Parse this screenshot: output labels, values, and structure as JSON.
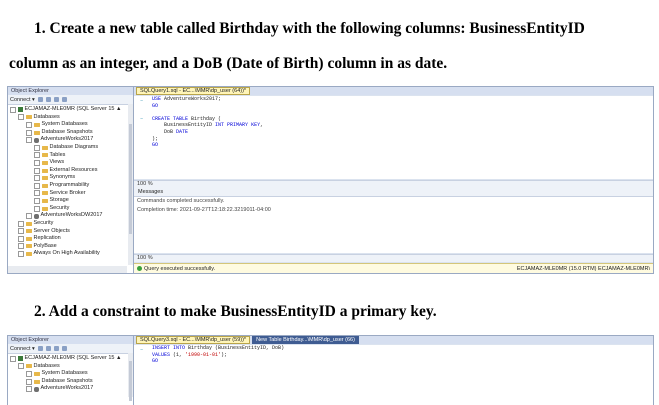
{
  "steps": {
    "step1_line1": "1.  Create a new table called Birthday with the following columns: BusinessEntityID",
    "step1_line2": "column as an integer, and a DoB (Date of Birth) column in as date.",
    "step2": "2.  Add a constraint to make BusinessEntityID a primary key."
  },
  "screenshot1": {
    "object_explorer": {
      "title": "Object Explorer",
      "connect_label": "Connect ▾",
      "tree": [
        "ECJAMAZ-MLE0MR (SQL Server 15 ▲",
        "Databases",
        "System Databases",
        "Database Snapshots",
        "AdventureWorks2017",
        "Database Diagrams",
        "Tables",
        "Views",
        "External Resources",
        "Synonyms",
        "Programmability",
        "Service Broker",
        "Storage",
        "Security",
        "AdventureWorksDW2017",
        "Security",
        "Server Objects",
        "Replication",
        "PolyBase",
        "Always On High Availability"
      ]
    },
    "tab": "SQLQuery1.sql - EC...\\MMR\\dp_user (64))*",
    "code": [
      "USE AdventureWorks2017;",
      "GO",
      "",
      "CREATE TABLE Birthday (",
      "    BusinessEntityID INT PRIMARY KEY,",
      "    DoB DATE",
      ");",
      "GO"
    ],
    "zoom": "100 %",
    "messages_tab": "Messages",
    "messages": [
      "Commands completed successfully.",
      "Completion time: 2021-09-27T12:18:22.3219011-04:00"
    ],
    "zoom2": "100 %",
    "status_left": "Query executed successfully.",
    "status_right": "ECJAMAZ-MLE0MR (15.0 RTM)  ECJAMAZ-MLE0MR\\"
  },
  "screenshot2": {
    "object_explorer": {
      "title": "Object Explorer",
      "connect_label": "Connect ▾",
      "tree": [
        "ECJAMAZ-MLE0MR (SQL Server 15 ▲",
        "Databases",
        "System Databases",
        "Database Snapshots",
        "AdventureWorks2017"
      ]
    },
    "tab_active": "SQLQuery3.sql - EC...\\MMR\\dp_user (59))*",
    "tab_inactive": "New Table Birthday...\\MMR\\dp_user (66)",
    "code": [
      "INSERT INTO Birthday (BusinessEntityID, DoB)",
      "VALUES (1, '1990-01-01');",
      "GO"
    ]
  },
  "colors": {
    "accent": "#3f5c92",
    "keyword": "#0000d8",
    "string": "#c00000"
  }
}
